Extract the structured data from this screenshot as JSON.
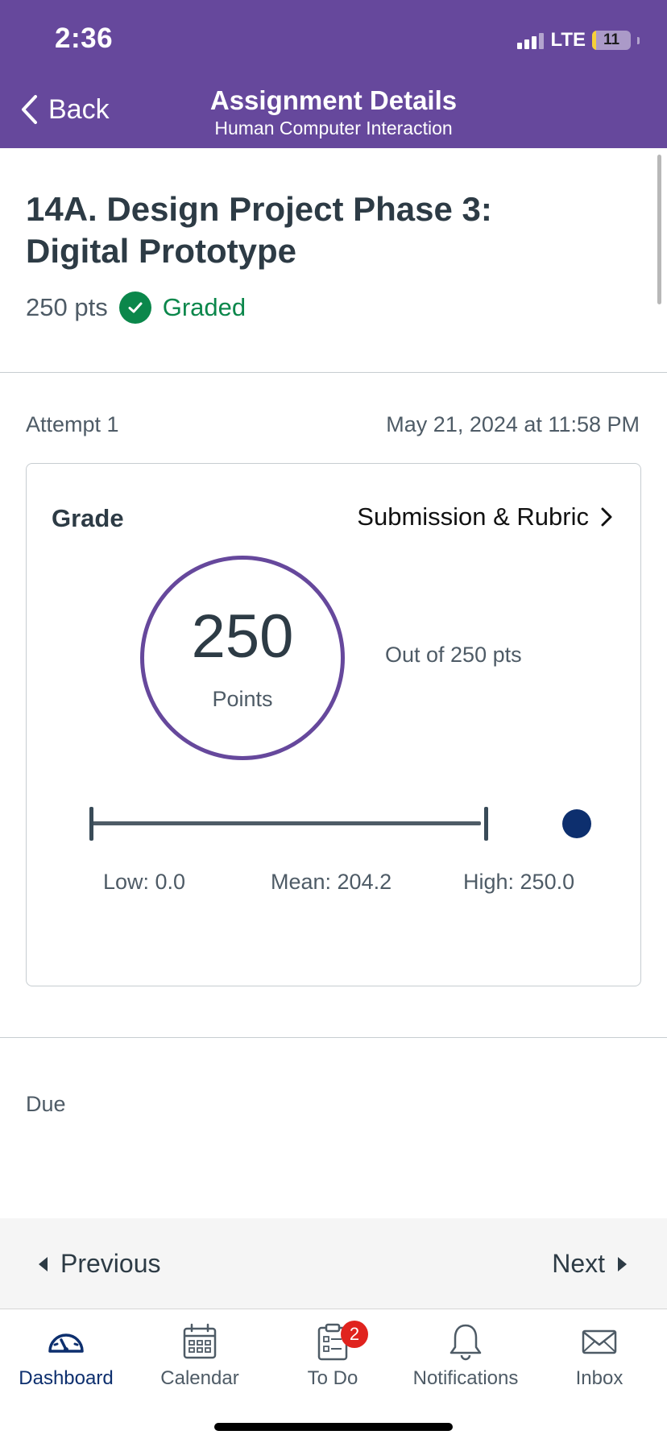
{
  "status_bar": {
    "time": "2:36",
    "network": "LTE",
    "battery": "11",
    "battery_level": 0.11
  },
  "header": {
    "back_label": "Back",
    "title": "Assignment Details",
    "subtitle": "Human Computer Interaction"
  },
  "assignment": {
    "title_line1": "14A. Design Project Phase 3:",
    "title_line2": "Digital Prototype",
    "points": "250 pts",
    "status": "Graded"
  },
  "attempt": {
    "label": "Attempt 1",
    "date": "May 21, 2024 at 11:58 PM"
  },
  "grade_card": {
    "title": "Grade",
    "rubric_link": "Submission & Rubric",
    "score": "250",
    "score_caption": "Points",
    "out_of": "Out of 250 pts",
    "low_label": "Low: 0.0",
    "mean_label": "Mean: 204.2",
    "high_label": "High: 250.0",
    "low": 0.0,
    "mean": 204.2,
    "high": 250.0,
    "accent_color": "#66489c"
  },
  "due": {
    "label": "Due"
  },
  "pager": {
    "previous": "Previous",
    "next": "Next"
  },
  "tabs": [
    {
      "label": "Dashboard",
      "icon": "dashboard-icon",
      "active": true
    },
    {
      "label": "Calendar",
      "icon": "calendar-icon"
    },
    {
      "label": "To Do",
      "icon": "todo-icon",
      "badge": "2"
    },
    {
      "label": "Notifications",
      "icon": "bell-icon"
    },
    {
      "label": "Inbox",
      "icon": "mail-icon"
    }
  ],
  "colors": {
    "brand": "#66489c",
    "success": "#0b874b",
    "active_tab": "#0d2f6e",
    "badge": "#e0231e"
  }
}
